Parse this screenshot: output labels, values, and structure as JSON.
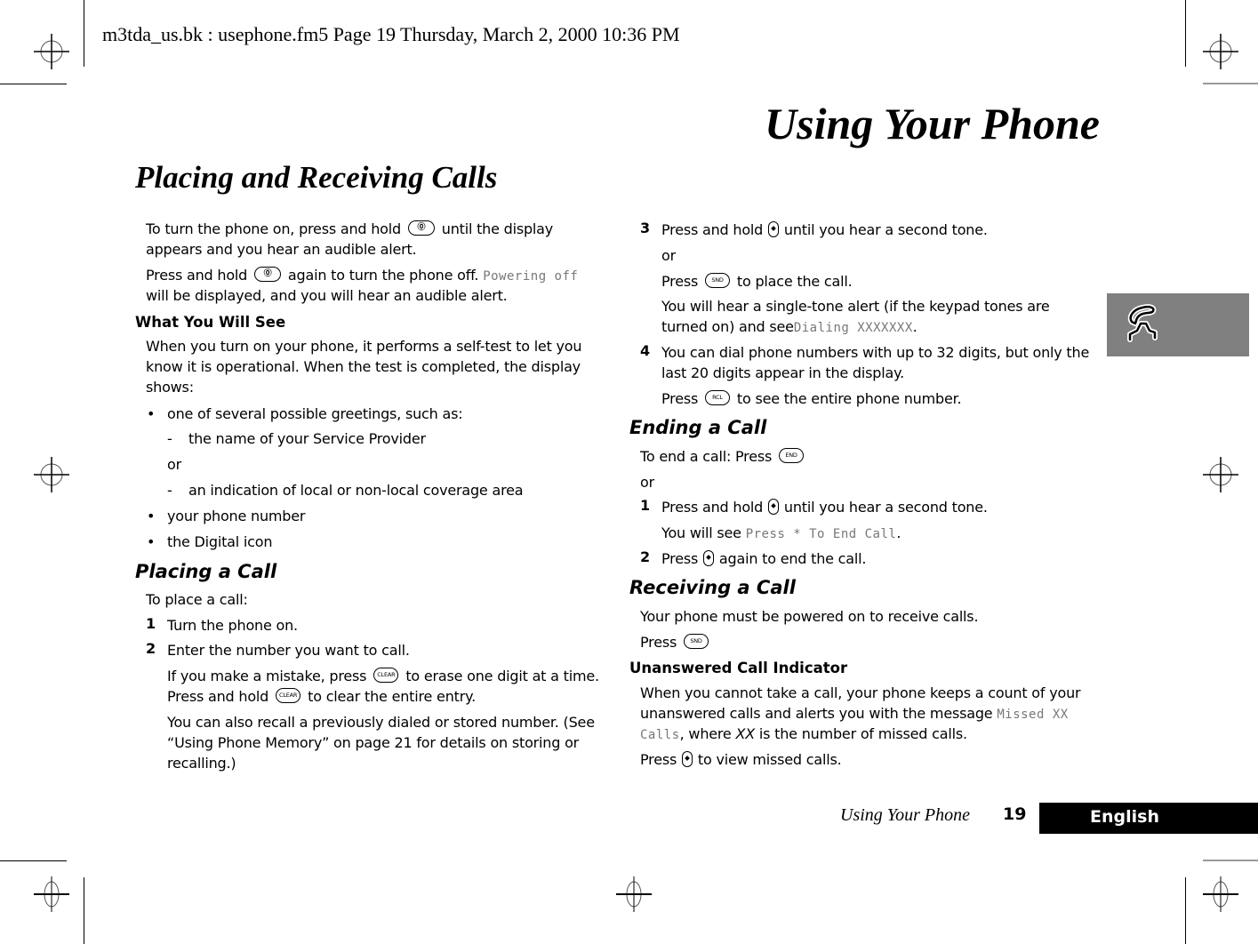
{
  "header": {
    "stamp": "m3tda_us.bk : usephone.fm5  Page 19  Thursday, March 2, 2000  10:36 PM"
  },
  "chapter_title": "Using Your Phone",
  "section_title": "Placing and Receiving Calls",
  "left_column": {
    "intro_1a": "To turn the phone on, press and hold",
    "intro_1b": "until the display",
    "intro_1c": "appears and you hear an audible alert.",
    "intro_2a": "Press and hold",
    "intro_2b": "again to turn the phone off.",
    "intro_2_lcd": "Powering off",
    "intro_2c": "will be displayed, and you will hear an audible alert.",
    "what_you_see": {
      "heading": "What You Will See",
      "p1": "When you turn on your phone, it performs a self-test to let you",
      "p2": "know it is operational. When the test is completed, the display",
      "p3": "shows:",
      "bullets": [
        "one of several possible greetings, such as:",
        "your phone number",
        "the Digital icon"
      ],
      "dash_1": "the name of your Service Provider",
      "or": "or",
      "dash_2": "an indication of local or non-local coverage area"
    },
    "placing": {
      "heading": "Placing a Call",
      "intro": "To place a call:",
      "step1_num": "1",
      "step1": "Turn the phone on.",
      "step2_num": "2",
      "step2": "Enter the number you want to call.",
      "mistake_a": "If you make a mistake, press",
      "mistake_b": "to erase one digit at a time.",
      "hold_a": "Press and hold",
      "hold_b": "to clear the entire entry.",
      "recall_1": "You can also recall a previously dialed or stored number. (See",
      "recall_2": "“Using Phone Memory” on page 21 for details on storing or",
      "recall_3": "recalling.)"
    }
  },
  "right_column": {
    "step3_num": "3",
    "step3a": "Press and hold",
    "step3b": "until you hear a second tone.",
    "or": "or",
    "snd_a": "Press",
    "snd_b": "to place the call.",
    "tone_1": "You will hear a single-tone alert (if the keypad tones are",
    "tone_2a": "turned on) and see",
    "tone_2_lcd": "Dialing XXXXXXX",
    "tone_2b": ".",
    "step4_num": "4",
    "step4_1": "You can dial phone numbers with up to 32 digits, but only the",
    "step4_2": "last 20 digits appear in the display.",
    "rcl_a": "Press",
    "rcl_b": "to see the entire phone number.",
    "ending": {
      "heading": "Ending a Call",
      "line1": "To end a call: Press",
      "or": "or",
      "step1_num": "1",
      "step1a": "Press and hold",
      "step1b": "until you hear a second tone.",
      "see_a": "You will see",
      "see_lcd": "Press * To End Call",
      "see_b": ".",
      "step2_num": "2",
      "step2a": "Press",
      "step2b": "again to end the call."
    },
    "receiving": {
      "heading": "Receiving a Call",
      "line1": "Your phone must be powered on to receive calls.",
      "press": "Press"
    },
    "unanswered": {
      "heading": "Unanswered Call Indicator",
      "l1": "When you cannot take a call, your phone keeps a count of your",
      "l2a": "unanswered calls and alerts you with the message",
      "l2_lcd": "Missed XX",
      "l3_lcd": "Calls",
      "l3a": ", where",
      "l3_xx": "XX",
      "l3b": "is the number of missed calls.",
      "view_a": "Press",
      "view_b": "to view missed calls."
    }
  },
  "keys": {
    "power": "⓪",
    "clear": "CLEAR",
    "snd": "SND",
    "rcl": "RCL",
    "end": "END"
  },
  "side_tab": {
    "icon": "phone-handset-icon",
    "color": "#808080"
  },
  "footer": {
    "title": "Using Your Phone",
    "page": "19",
    "language": "English"
  }
}
